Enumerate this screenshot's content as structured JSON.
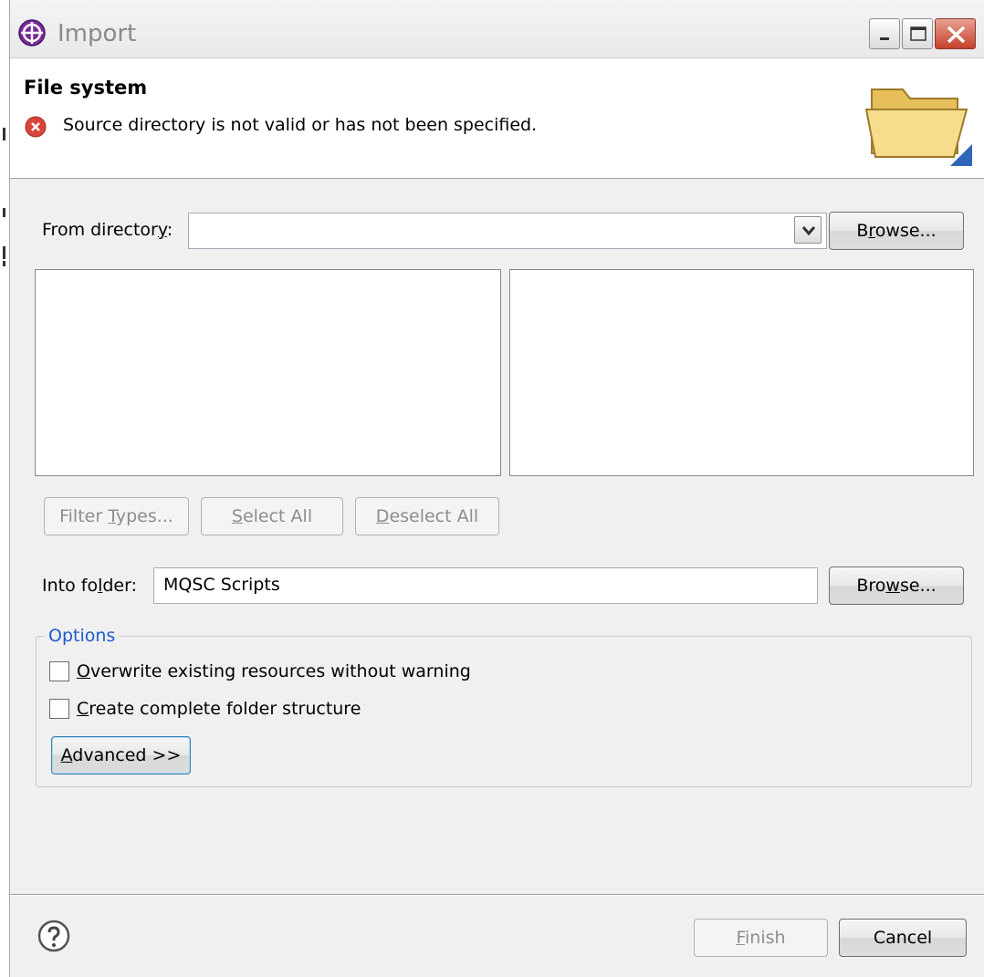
{
  "window": {
    "title": "Import"
  },
  "header": {
    "page_title": "File system",
    "error_message": "Source directory is not valid or has not been specified."
  },
  "from_directory": {
    "label": "From director",
    "label_accel": "y",
    "label_suffix": ":",
    "value": "",
    "browse_label_pre": "B",
    "browse_label_accel": "r",
    "browse_label_post": "owse..."
  },
  "selection_buttons": {
    "filter_pre": "Filter ",
    "filter_accel": "T",
    "filter_post": "ypes...",
    "select_accel": "S",
    "select_post": "elect All",
    "deselect_accel": "D",
    "deselect_post": "eselect All"
  },
  "into_folder": {
    "label_pre": "Into fo",
    "label_accel": "l",
    "label_post": "der:",
    "value": "MQSC Scripts",
    "browse_label_pre": "Bro",
    "browse_label_accel": "w",
    "browse_label_post": "se..."
  },
  "options": {
    "legend": "Options",
    "overwrite_accel": "O",
    "overwrite_post": "verwrite existing resources without warning",
    "overwrite_checked": false,
    "structure_accel": "C",
    "structure_post": "reate complete folder structure",
    "structure_checked": false,
    "advanced_accel": "A",
    "advanced_post": "dvanced >>"
  },
  "footer": {
    "finish_accel": "F",
    "finish_post": "inish",
    "cancel_label": "Cancel"
  },
  "colors": {
    "accent": "#1c5cd0",
    "error": "#d9453a",
    "folder": "#f2d37a"
  },
  "icons": [
    "import-wizard-icon",
    "error-icon",
    "folder-icon",
    "help-icon",
    "dropdown-arrow-icon"
  ]
}
